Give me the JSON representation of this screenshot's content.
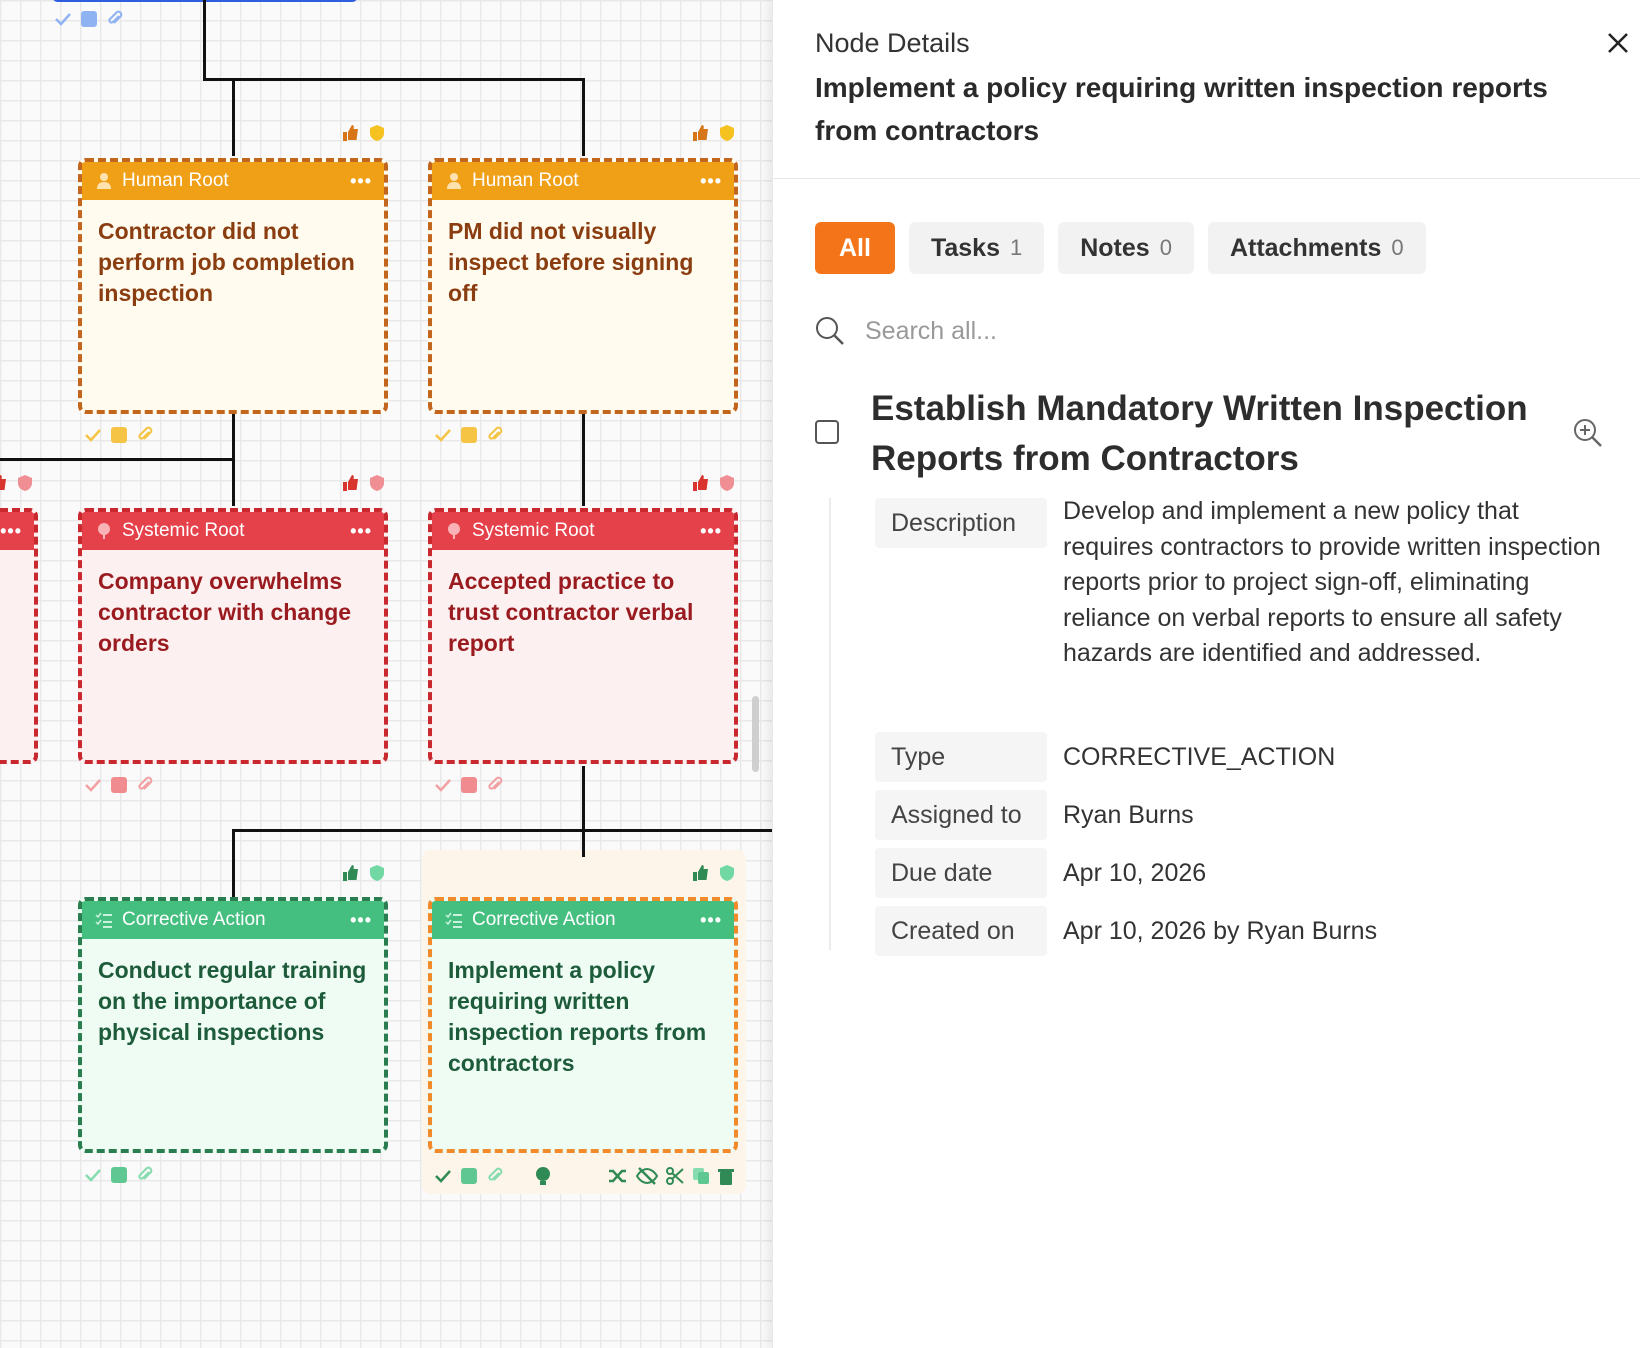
{
  "nodes": {
    "human1": {
      "type": "Human Root",
      "text": "Contractor did not perform job completion inspection"
    },
    "human2": {
      "type": "Human Root",
      "text": "PM did not visually inspect before signing off"
    },
    "sys1": {
      "type": "Systemic Root",
      "text": "Company overwhelms contractor with change orders"
    },
    "sys2": {
      "type": "Systemic Root",
      "text": "Accepted practice to trust contractor verbal report"
    },
    "corr1": {
      "type": "Corrective Action",
      "text": "Conduct regular training on the importance of physical inspections"
    },
    "corr2": {
      "type": "Corrective Action",
      "text": "Implement a policy requiring written inspection reports from contractors"
    },
    "more_glyph": "•••"
  },
  "panel": {
    "heading": "Node Details",
    "title": "Implement a policy requiring written inspection reports from contractors",
    "tabs": [
      {
        "label": "All",
        "count": ""
      },
      {
        "label": "Tasks",
        "count": "1"
      },
      {
        "label": "Notes",
        "count": "0"
      },
      {
        "label": "Attachments",
        "count": "0"
      }
    ],
    "search_placeholder": "Search all...",
    "task": {
      "title": "Establish Mandatory Written Inspection Reports from Contractors",
      "props": [
        {
          "key": "Description",
          "value": "Develop and implement a new policy that requires contractors to provide written inspection reports prior to project sign-off, eliminating reliance on verbal reports to ensure all safety hazards are identified and addressed."
        },
        {
          "key": "Type",
          "value": "CORRECTIVE_ACTION"
        },
        {
          "key": "Assigned to",
          "value": "Ryan Burns"
        },
        {
          "key": "Due date",
          "value": "Apr 10, 2026"
        },
        {
          "key": "Created on",
          "value": "Apr 10, 2026 by Ryan Burns"
        }
      ]
    }
  },
  "colors": {
    "accent": "#f47519",
    "human": "#f0a017",
    "systemic": "#e5414a",
    "corrective": "#45bf80"
  }
}
